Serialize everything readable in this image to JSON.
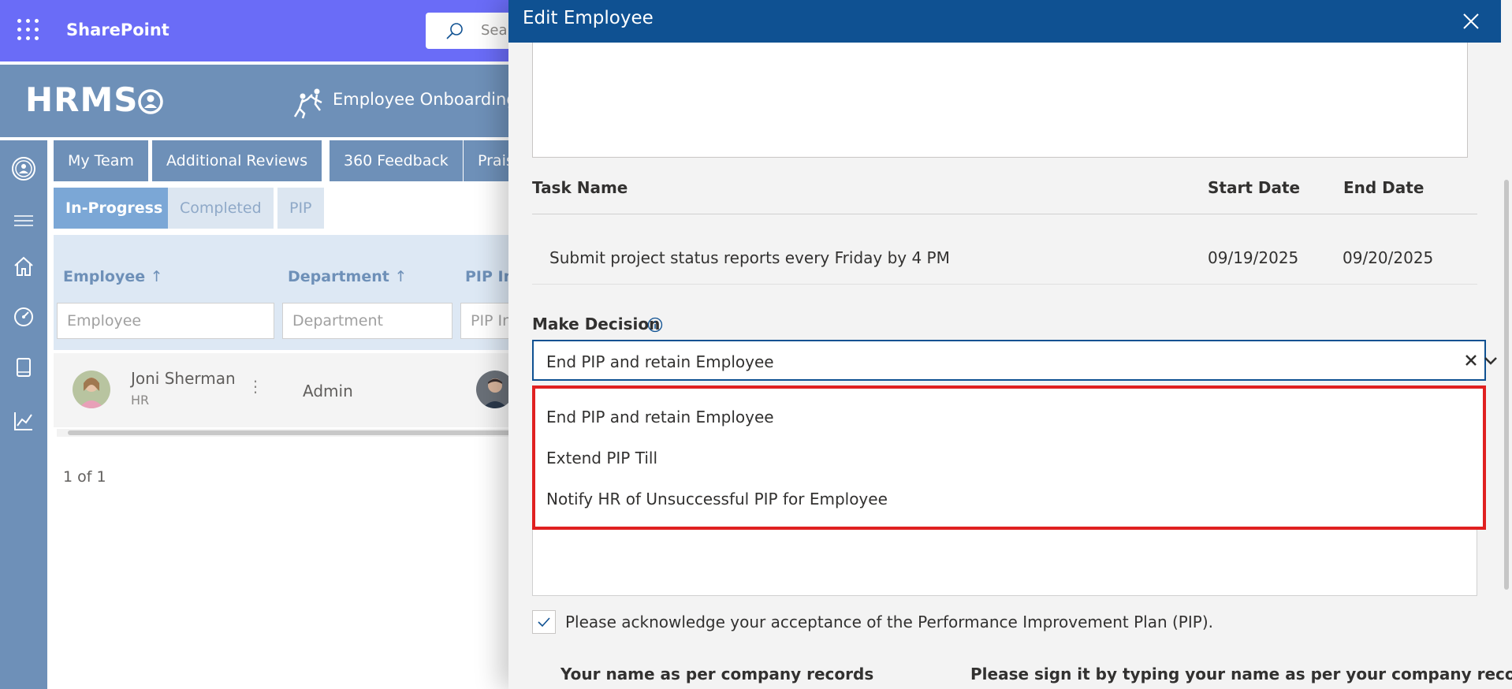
{
  "suite_bar": {
    "title": "SharePoint",
    "search_placeholder": "Sea",
    "icons": [
      "waffle-icon",
      "search-icon"
    ]
  },
  "app_header": {
    "logo": "HRMS",
    "onboarding_label": "Employee Onboarding"
  },
  "left_nav": {
    "icons": [
      "profile-icon",
      "menu-icon",
      "home-icon",
      "dashboard-icon",
      "book-icon",
      "chart-icon"
    ]
  },
  "main": {
    "tabs": [
      "My Team",
      "Additional Reviews",
      "360 Feedback",
      "Prais"
    ],
    "subtabs": [
      "In-Progress",
      "Completed",
      "PIP"
    ],
    "active_subtab": "In-Progress",
    "columns": [
      {
        "label": "Employee",
        "sort": "↑"
      },
      {
        "label": "Department",
        "sort": "↑"
      },
      {
        "label": "PIP In",
        "sort": ""
      }
    ],
    "filters": [
      "Employee",
      "Department",
      "PIP In"
    ],
    "rows": [
      {
        "name": "Joni Sherman",
        "role": "HR",
        "more": "⋮",
        "department": "Admin"
      }
    ],
    "pager": "1 of 1"
  },
  "panel": {
    "title": "Edit Employee",
    "task_table": {
      "headers": {
        "task": "Task Name",
        "start": "Start Date",
        "end": "End Date"
      },
      "rows": [
        {
          "task": "Submit project status reports every Friday by 4 PM",
          "start": "09/19/2025",
          "end": "09/20/2025"
        }
      ]
    },
    "decision": {
      "label": "Make Decision",
      "selected": "End PIP and retain Employee",
      "options": [
        "End PIP and retain Employee",
        "Extend PIP Till",
        "Notify HR of Unsuccessful PIP for Employee"
      ]
    },
    "acknowledge_text": "Please acknowledge your acceptance of the Performance Improvement Plan (PIP).",
    "acknowledge_checked": true,
    "name_label": "Your name as per company records",
    "sign_label": "Please sign it by typing your name as per your company records",
    "required_mark": "*"
  },
  "colors": {
    "suite_bar": "#6a6cf7",
    "app_header": "#6e90b8",
    "panel_header": "#0f5192",
    "highlight_border": "#e02020"
  }
}
